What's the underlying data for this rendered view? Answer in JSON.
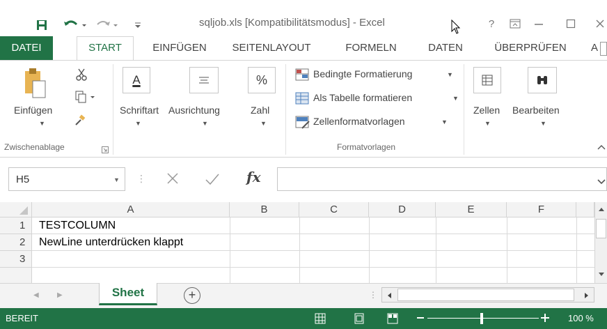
{
  "window": {
    "title": "sqljob.xls  [Kompatibilitätsmodus] - Excel",
    "help_label": "?"
  },
  "colors": {
    "accent": "#217346",
    "ribbon_bg": "#ffffff",
    "header_bg": "#f3f3f3"
  },
  "menu": {
    "tabs": [
      "DATEI",
      "START",
      "EINFÜGEN",
      "SEITENLAYOUT",
      "FORMELN",
      "DATEN",
      "ÜBERPRÜFEN",
      "A"
    ],
    "active": "START"
  },
  "ribbon": {
    "clipboard": {
      "paste_label": "Einfügen",
      "group_label": "Zwischenablage"
    },
    "font_label": "Schriftart",
    "alignment_label": "Ausrichtung",
    "number_label": "Zahl",
    "styles": {
      "conditional_label": "Bedingte Formatierung",
      "table_label": "Als Tabelle formatieren",
      "cellstyles_label": "Zellenformatvorlagen",
      "group_label": "Formatvorlagen"
    },
    "cells_label": "Zellen",
    "editing_label": "Bearbeiten",
    "number_glyph": "%",
    "font_glyph": "A"
  },
  "formula_bar": {
    "name_box": "H5",
    "fx_label": "fx",
    "formula": ""
  },
  "grid": {
    "columns": [
      "A",
      "B",
      "C",
      "D",
      "E",
      "F"
    ],
    "rows": [
      {
        "num": "1",
        "a": "TESTCOLUMN"
      },
      {
        "num": "2",
        "a": "NewLine unterdrücken klappt"
      },
      {
        "num": "3",
        "a": ""
      }
    ]
  },
  "sheets": {
    "tabs": [
      "Sheet"
    ],
    "add_label": "+"
  },
  "status": {
    "ready": "BEREIT",
    "zoom": "100 %"
  }
}
